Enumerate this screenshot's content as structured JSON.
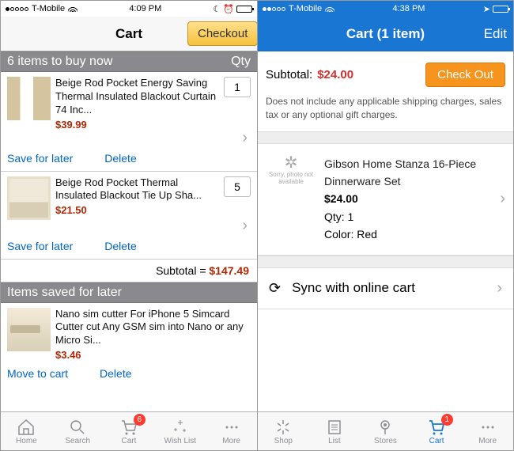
{
  "amazon": {
    "status": {
      "carrier": "T-Mobile",
      "time": "4:09 PM"
    },
    "nav": {
      "title": "Cart",
      "checkout": "Checkout"
    },
    "section_buy": {
      "label": "6 items to buy now",
      "qty_label": "Qty"
    },
    "items": [
      {
        "name": "Beige Rod Pocket Energy Saving Thermal Insulated Blackout Curtain 74 Inc...",
        "price": "$39.99",
        "qty": "1"
      },
      {
        "name": "Beige Rod Pocket Thermal Insulated Blackout Tie Up Sha...",
        "price": "$21.50",
        "qty": "5"
      }
    ],
    "actions": {
      "save": "Save for later",
      "delete": "Delete",
      "move": "Move to cart"
    },
    "subtotal": {
      "label": "Subtotal = ",
      "value": "$147.49"
    },
    "section_saved": "Items saved for later",
    "saved": [
      {
        "name": "Nano sim cutter For iPhone 5 Simcard Cutter cut Any GSM sim into Nano or any Micro Si...",
        "price": "$3.46"
      }
    ],
    "tabs": [
      "Home",
      "Search",
      "Cart",
      "Wish List",
      "More"
    ],
    "tab_badge": "6"
  },
  "walmart": {
    "status": {
      "carrier": "T-Mobile",
      "time": "4:38 PM"
    },
    "nav": {
      "title": "Cart (1 item)",
      "edit": "Edit"
    },
    "subtotal": {
      "label": "Subtotal:",
      "value": "$24.00",
      "checkout": "Check Out"
    },
    "note": "Does not include any applicable shipping charges, sales tax or any optional gift charges.",
    "photo_na": "Sorry, photo not available",
    "item": {
      "name": "Gibson Home Stanza 16-Piece Dinnerware Set",
      "price": "$24.00",
      "qty": "Qty:  1",
      "color": "Color: Red"
    },
    "sync": "Sync with online cart",
    "tabs": [
      "Shop",
      "List",
      "Stores",
      "Cart",
      "More"
    ],
    "tab_badge": "1"
  }
}
